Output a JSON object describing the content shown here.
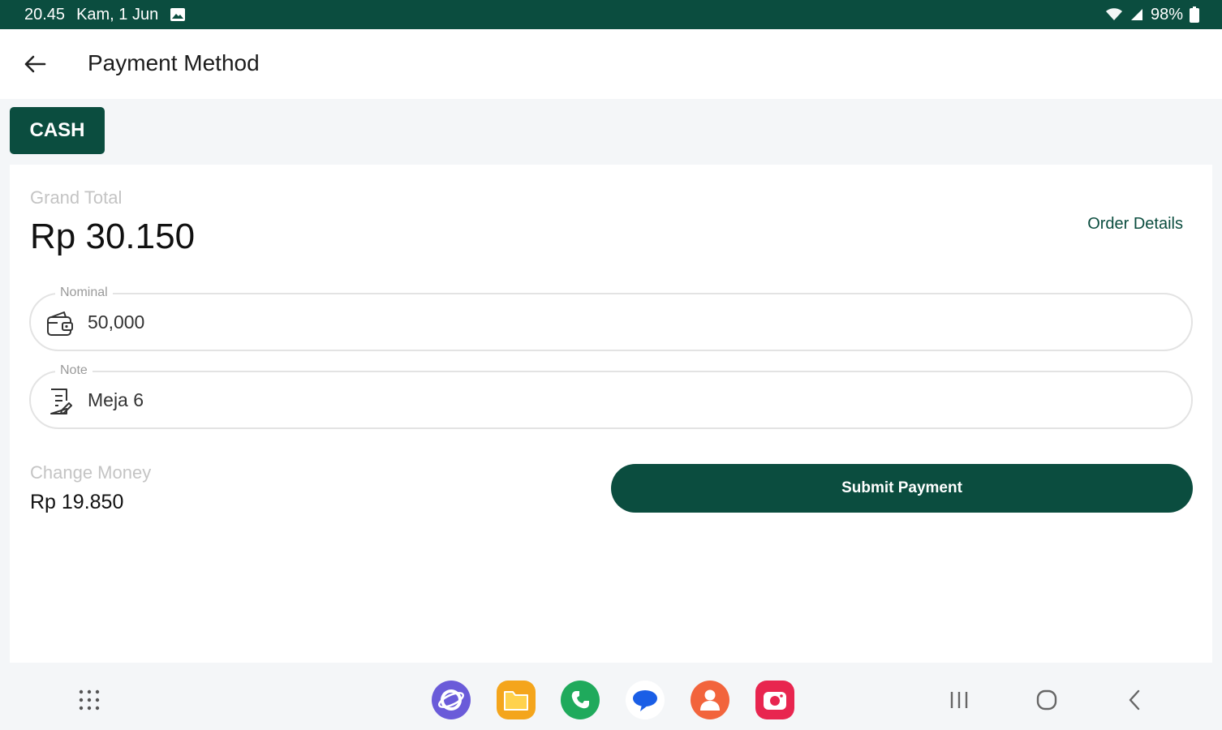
{
  "status_bar": {
    "time": "20.45",
    "date": "Kam, 1 Jun",
    "battery": "98%"
  },
  "header": {
    "title": "Payment Method"
  },
  "tabs": [
    {
      "label": "CASH",
      "selected": true
    }
  ],
  "summary": {
    "grand_total_label": "Grand Total",
    "grand_total_value": "Rp 30.150",
    "order_details_link": "Order Details"
  },
  "form": {
    "nominal": {
      "label": "Nominal",
      "value": "50,000"
    },
    "note": {
      "label": "Note",
      "value": "Meja 6"
    }
  },
  "change": {
    "label": "Change Money",
    "value": "Rp 19.850"
  },
  "actions": {
    "submit_label": "Submit Payment"
  },
  "colors": {
    "primary": "#0b4d3f",
    "muted_text": "#c4c4c4",
    "field_border": "#e3e3e3"
  },
  "nav": {
    "dock_apps": [
      "internet-icon",
      "my-files-icon",
      "phone-icon",
      "messages-icon",
      "contacts-icon",
      "camera-icon"
    ]
  }
}
